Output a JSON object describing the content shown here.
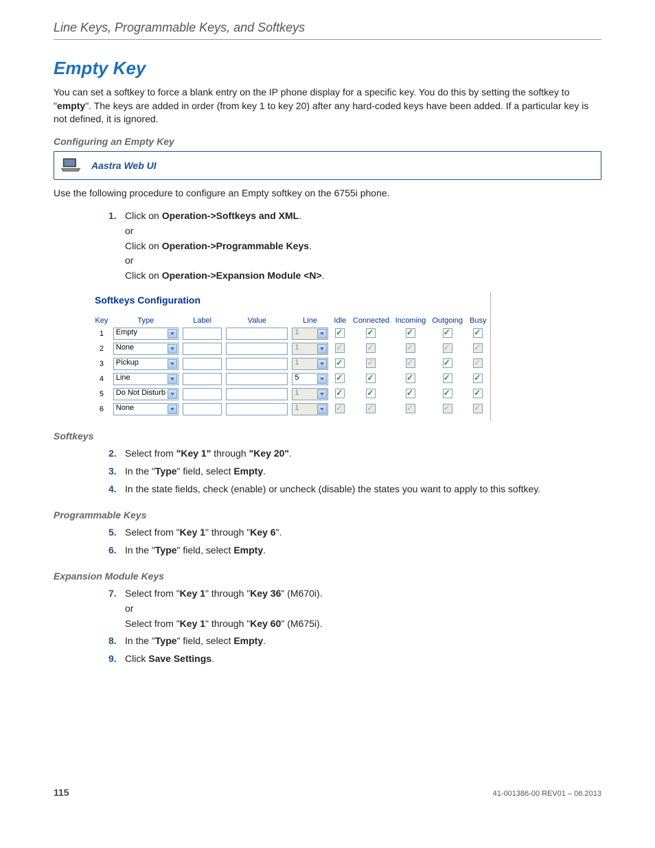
{
  "header": {
    "running": "Line Keys, Programmable Keys, and Softkeys"
  },
  "title": "Empty Key",
  "intro": {
    "p1a": "You can set a softkey to force a blank entry on the IP phone display for a specific key. You do this by setting the softkey to \"",
    "p1b": "empty",
    "p1c": "\". The keys are added in order (from key 1 to key 20) after any hard-coded keys have been added. If a particular key is not defined, it is ignored."
  },
  "h_configuring": "Configuring an Empty Key",
  "uibox_label": "Aastra Web UI",
  "intro2": "Use the following procedure to configure an Empty softkey on the 6755i phone.",
  "step1": {
    "num": "1.",
    "a": "Click on ",
    "b1": "Operation->Softkeys and XML",
    "c1": ".",
    "or": "or",
    "b2": "Operation->Programmable Keys",
    "c2": ".",
    "b3": "Operation->Expansion Module <N>",
    "c3": "."
  },
  "webui": {
    "title": "Softkeys Configuration",
    "cols": [
      "Key",
      "Type",
      "Label",
      "Value",
      "Line",
      "Idle",
      "Connected",
      "Incoming",
      "Outgoing",
      "Busy"
    ],
    "rows": [
      {
        "key": "1",
        "type": "Empty",
        "line": "1",
        "line_disabled": true,
        "states": [
          "g",
          "g",
          "g",
          "g",
          "g"
        ]
      },
      {
        "key": "2",
        "type": "None",
        "line": "1",
        "line_disabled": true,
        "states": [
          "d",
          "d",
          "d",
          "d",
          "d"
        ]
      },
      {
        "key": "3",
        "type": "Pickup",
        "line": "1",
        "line_disabled": true,
        "states": [
          "g",
          "d",
          "d",
          "g",
          "d"
        ]
      },
      {
        "key": "4",
        "type": "Line",
        "line": "5",
        "line_disabled": false,
        "states": [
          "g",
          "g",
          "g",
          "g",
          "g"
        ]
      },
      {
        "key": "5",
        "type": "Do Not Disturb",
        "line": "1",
        "line_disabled": true,
        "states": [
          "g",
          "g",
          "g",
          "g",
          "g"
        ]
      },
      {
        "key": "6",
        "type": "None",
        "line": "1",
        "line_disabled": true,
        "states": [
          "d",
          "d",
          "d",
          "d",
          "d"
        ]
      }
    ]
  },
  "h_softkeys": "Softkeys",
  "step2": {
    "num": "2.",
    "a": "Select from ",
    "b1": "\"Key 1\"",
    "c": " through ",
    "b2": "\"Key 20\"",
    "d": "."
  },
  "step3": {
    "num": "3.",
    "a": "In the \"",
    "b1": "Type",
    "c": "\" field, select ",
    "b2": "Empty",
    "d": "."
  },
  "step4": {
    "num": "4.",
    "a": "In the state fields, check (enable) or uncheck (disable) the states you want to apply to this softkey."
  },
  "h_prog": "Programmable Keys",
  "step5": {
    "num": "5.",
    "a": "Select from \"",
    "b1": "Key 1",
    "c": "\" through \"",
    "b2": "Key 6",
    "d": "\"."
  },
  "step6": {
    "num": "6.",
    "a": "In the \"",
    "b1": "Type",
    "c": "\" field, select ",
    "b2": "Empty",
    "d": "."
  },
  "h_exp": "Expansion Module Keys",
  "step7": {
    "num": "7.",
    "a": "Select from \"",
    "b1": "Key 1",
    "c": "\" through \"",
    "b2": "Key 36",
    "d": "\" (M670i).",
    "or": "or",
    "a2": "Select from \"",
    "b3": "Key 1",
    "c2": "\" through \"",
    "b4": "Key 60",
    "d2": "\" (M675i)."
  },
  "step8": {
    "num": "8.",
    "a": "In the \"",
    "b1": "Type",
    "c": "\" field, select ",
    "b2": "Empty",
    "d": "."
  },
  "step9": {
    "num": "9.",
    "a": " Click ",
    "b1": "Save Settings",
    "d": "."
  },
  "footer": {
    "page": "115",
    "doc": "41-001386-00 REV01 – 06.2013"
  }
}
